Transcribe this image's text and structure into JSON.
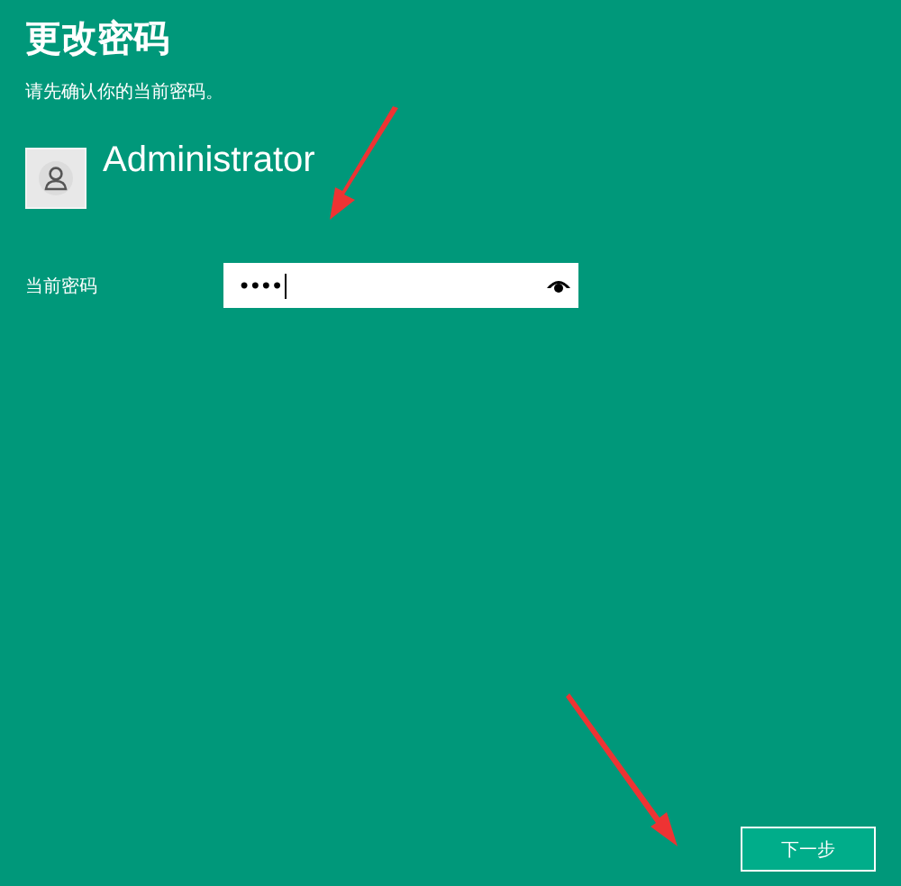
{
  "title": "更改密码",
  "subtitle": "请先确认你的当前密码。",
  "user": {
    "name": "Administrator"
  },
  "password_field": {
    "label": "当前密码",
    "value": "••••",
    "focused": true
  },
  "buttons": [
    {
      "label": "下一步"
    }
  ]
}
